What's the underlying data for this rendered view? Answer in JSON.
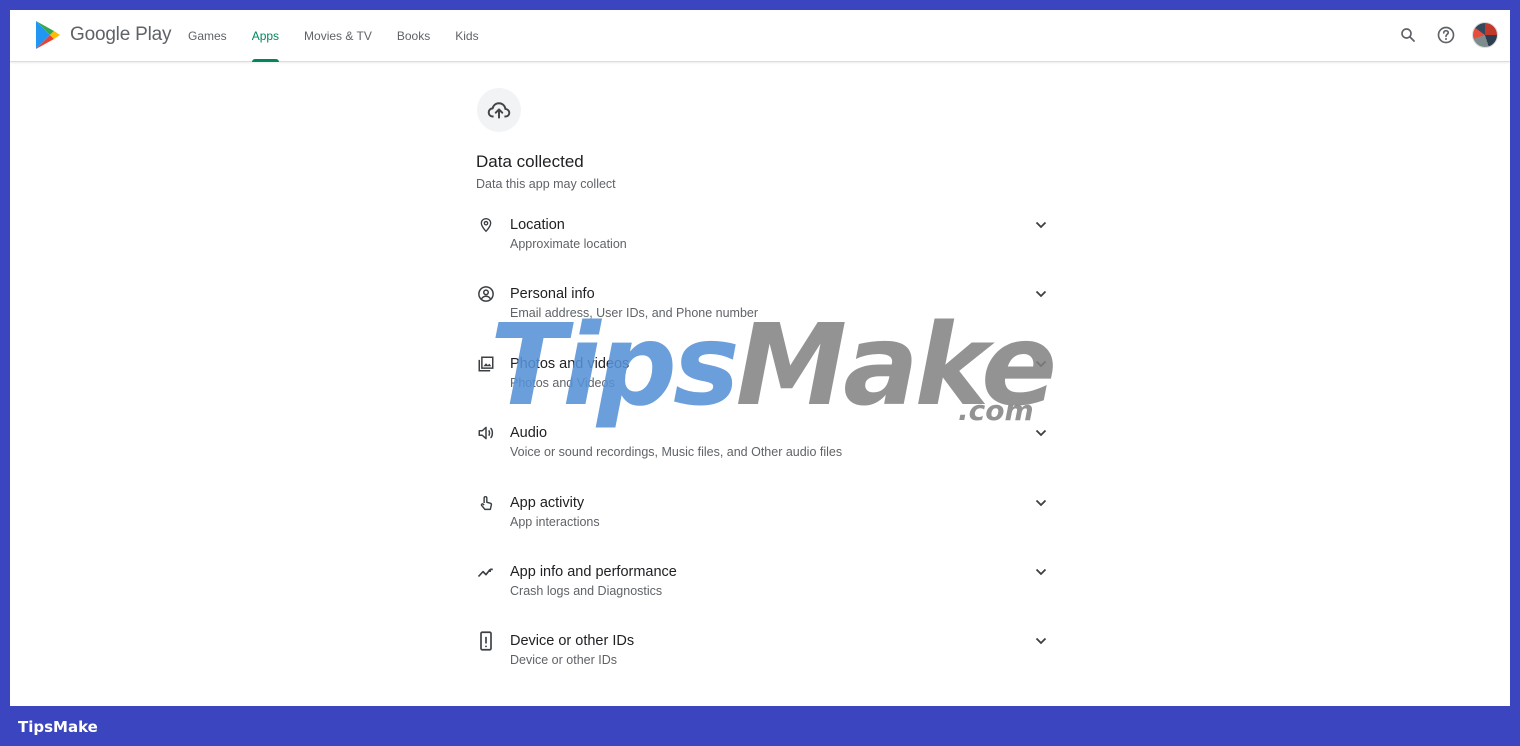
{
  "header": {
    "logo_text": "Google Play",
    "nav": [
      {
        "label": "Games",
        "active": false
      },
      {
        "label": "Apps",
        "active": true
      },
      {
        "label": "Movies & TV",
        "active": false
      },
      {
        "label": "Books",
        "active": false
      },
      {
        "label": "Kids",
        "active": false
      }
    ],
    "icons": [
      "search-icon",
      "help-icon",
      "account-avatar"
    ],
    "accent_color": "#01875f"
  },
  "section": {
    "icon": "cloud-upload-icon",
    "title": "Data collected",
    "subtitle": "Data this app may collect",
    "items": [
      {
        "icon": "location-icon",
        "title": "Location",
        "subtitle": "Approximate location"
      },
      {
        "icon": "person-icon",
        "title": "Personal info",
        "subtitle": "Email address, User IDs, and Phone number"
      },
      {
        "icon": "photos-icon",
        "title": "Photos and videos",
        "subtitle": "Photos and Videos"
      },
      {
        "icon": "audio-icon",
        "title": "Audio",
        "subtitle": "Voice or sound recordings, Music files, and Other audio files"
      },
      {
        "icon": "touch-icon",
        "title": "App activity",
        "subtitle": "App interactions"
      },
      {
        "icon": "performance-icon",
        "title": "App info and performance",
        "subtitle": "Crash logs and Diagnostics"
      },
      {
        "icon": "device-icon",
        "title": "Device or other IDs",
        "subtitle": "Device or other IDs"
      }
    ]
  },
  "watermark": {
    "part1": "Tips",
    "part2": "Make",
    "suffix": ".com"
  },
  "footer_brand": "TipsMake",
  "frame_color": "#3b45bf"
}
